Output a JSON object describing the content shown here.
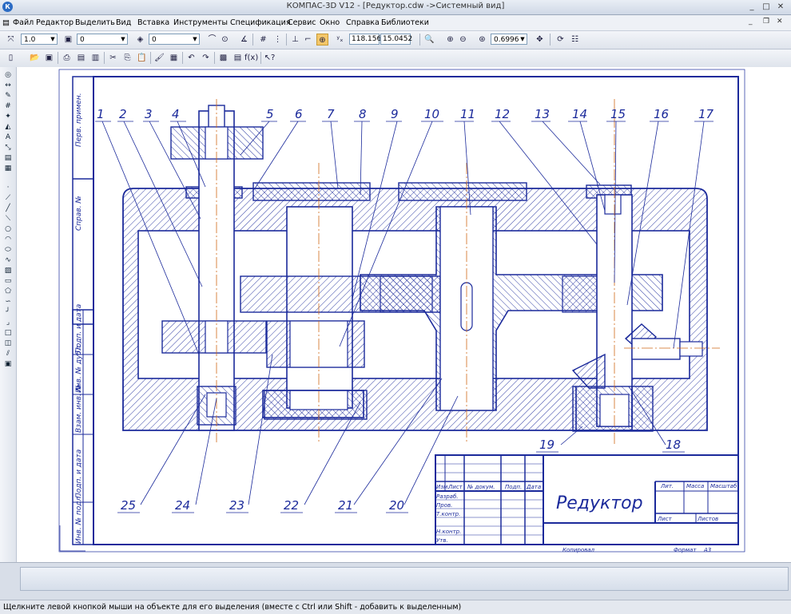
{
  "window": {
    "title": "КОМПАС-3D V12 - [Редуктор.cdw ->Системный вид]",
    "app_icon": "kompas-logo-icon"
  },
  "menu": [
    "Файл",
    "Редактор",
    "Выделить",
    "Вид",
    "Вставка",
    "Инструменты",
    "Спецификация",
    "Сервис",
    "Окно",
    "Справка",
    "Библиотеки"
  ],
  "toolbar1": {
    "step": "1.0",
    "layer": "0",
    "style": "0",
    "coord_x": "118.156",
    "coord_y": "15.0452",
    "zoom": "0.6996"
  },
  "drawing": {
    "title": "Редуктор",
    "callouts": [
      "1",
      "2",
      "3",
      "4",
      "5",
      "6",
      "7",
      "8",
      "9",
      "10",
      "11",
      "12",
      "13",
      "14",
      "15",
      "16",
      "17",
      "18",
      "19",
      "20",
      "21",
      "22",
      "23",
      "24",
      "25"
    ],
    "side_labels": [
      "Перв. примен.",
      "Справ. №",
      "Подп. и дата",
      "Инв. № дубл.",
      "Взам. инв. №",
      "Подп. и дата",
      "Инв. № подл."
    ],
    "stamp": {
      "col_headers": [
        "Изм.",
        "Лист",
        "№ докум.",
        "Подп.",
        "Дата"
      ],
      "rows": [
        "Разраб.",
        "Пров.",
        "Т.контр.",
        "Н.контр.",
        "Утв."
      ],
      "lit": "Лит.",
      "mass": "Масса",
      "scale": "Масштаб",
      "sheet": "Лист",
      "sheets": "Листов",
      "copied": "Копировал",
      "format": "Формат",
      "format_value": "А3"
    }
  },
  "status": "Щелкните левой кнопкой мыши на объекте для его выделения (вместе с Ctrl или Shift - добавить к выделенным)",
  "colors": {
    "line": "#1b2a9b",
    "hatch": "#1b2a9b",
    "axis": "#d06a1a",
    "background": "#ffffff"
  }
}
